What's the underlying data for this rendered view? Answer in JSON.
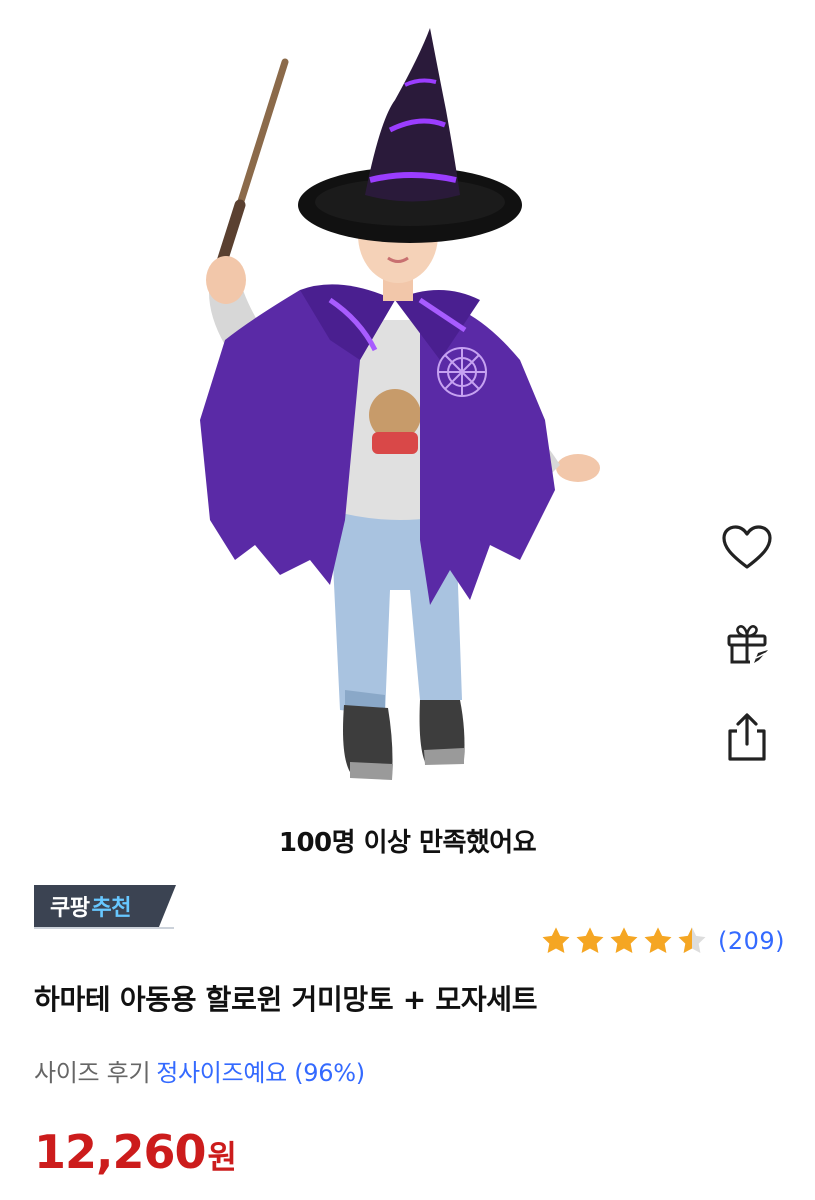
{
  "actions": {
    "wishlist_icon": "heart-icon",
    "gift_icon": "gift-icon",
    "share_icon": "share-icon"
  },
  "satisfaction": {
    "count": "100",
    "text": "명 이상 만족했어요"
  },
  "badge": {
    "part1": "쿠팡",
    "part2": "추천"
  },
  "rating": {
    "stars": 4.5,
    "count": "(209)"
  },
  "product": {
    "title": "하마테 아동용 할로윈 거미망토 + 모자세트"
  },
  "size_review": {
    "label": "사이즈 후기",
    "value": "정사이즈예요 (96%)"
  },
  "price": {
    "amount": "12,260",
    "unit": "원"
  },
  "colors": {
    "price": "#cc1c1c",
    "link": "#346aff",
    "star": "#f5a623",
    "badge_bg": "#3b4352",
    "badge_accent": "#67c7ff"
  }
}
